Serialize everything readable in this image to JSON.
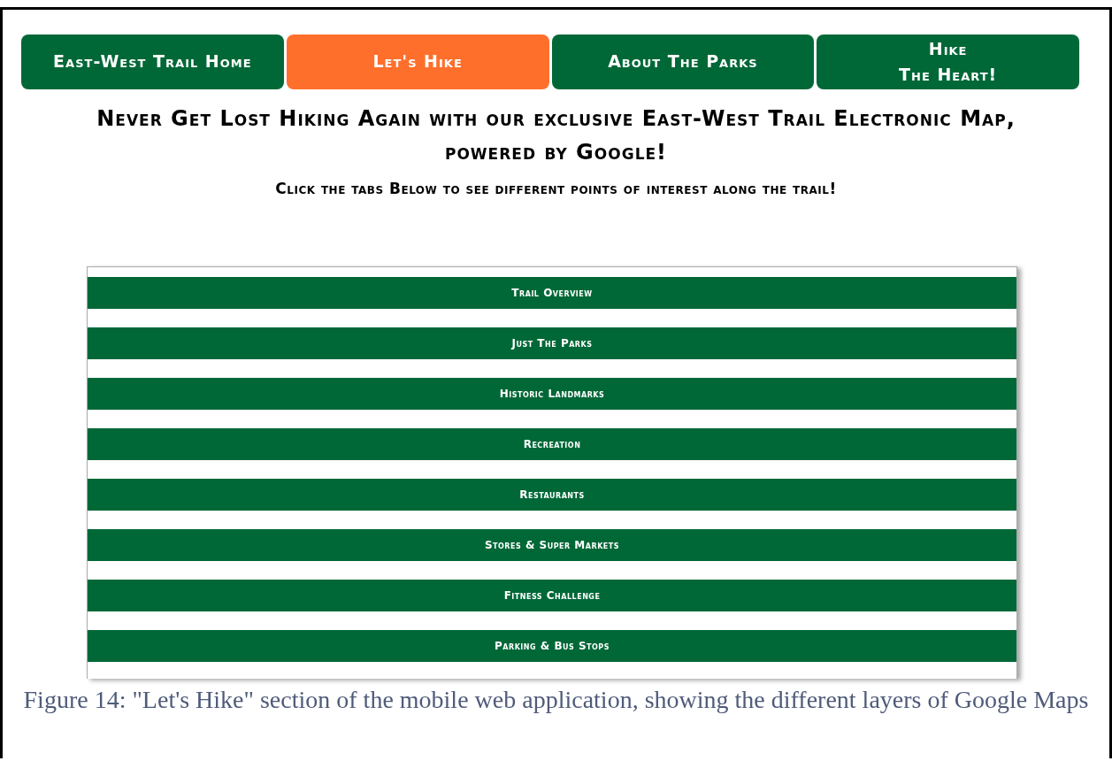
{
  "nav_tabs": [
    {
      "label": "East-West Trail Home",
      "selected": false
    },
    {
      "label": "Let's Hike",
      "selected": true
    },
    {
      "label": "About The Parks",
      "selected": false
    },
    {
      "label": "Hike\nThe Heart!",
      "selected": false
    }
  ],
  "heading": "Never Get Lost Hiking Again with our exclusive East-West Trail Electronic Map, powered by Google!",
  "subheading": "Click the tabs Below to see different points of interest along the trail!",
  "layer_tabs": [
    {
      "label": "Trail Overview"
    },
    {
      "label": "Just The Parks"
    },
    {
      "label": "Historic Landmarks"
    },
    {
      "label": "Recreation"
    },
    {
      "label": "Restaurants"
    },
    {
      "label": "Stores & Super Markets"
    },
    {
      "label": "Fitness Challenge"
    },
    {
      "label": "Parking & Bus Stops"
    }
  ],
  "caption": "Figure 14: \"Let's Hike\" section of the mobile web application, showing the different layers of Google Maps"
}
